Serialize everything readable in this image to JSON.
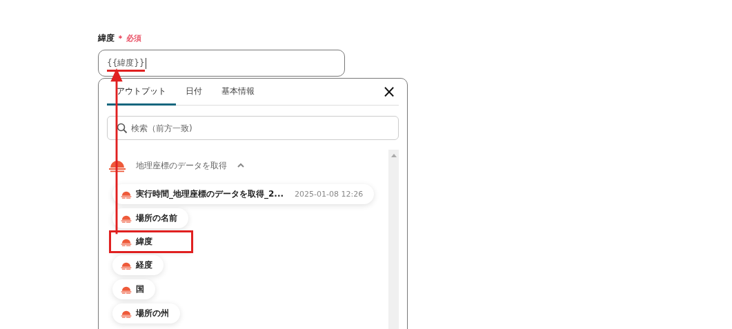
{
  "field": {
    "label": "緯度",
    "required_mark": "＊",
    "required_text": "必須",
    "value": "{{緯度}}",
    "underlined": true
  },
  "panel": {
    "tabs": [
      {
        "label": "アウトプット",
        "selected": true
      },
      {
        "label": "日付",
        "selected": false
      },
      {
        "label": "基本情報",
        "selected": false
      }
    ],
    "close": "×",
    "search": {
      "placeholder": "検索（前方一致)"
    },
    "group": {
      "title": "地理座標のデータを取得",
      "expanded": true,
      "items": [
        {
          "label": "実行時間_地理座標のデータを取得_2...",
          "value": "2025-01-08 12:26",
          "highlighted": false
        },
        {
          "label": "場所の名前",
          "highlighted": false
        },
        {
          "label": "緯度",
          "highlighted": true
        },
        {
          "label": "経度",
          "highlighted": false
        },
        {
          "label": "国",
          "highlighted": false
        },
        {
          "label": "場所の州",
          "highlighted": false
        }
      ]
    }
  }
}
